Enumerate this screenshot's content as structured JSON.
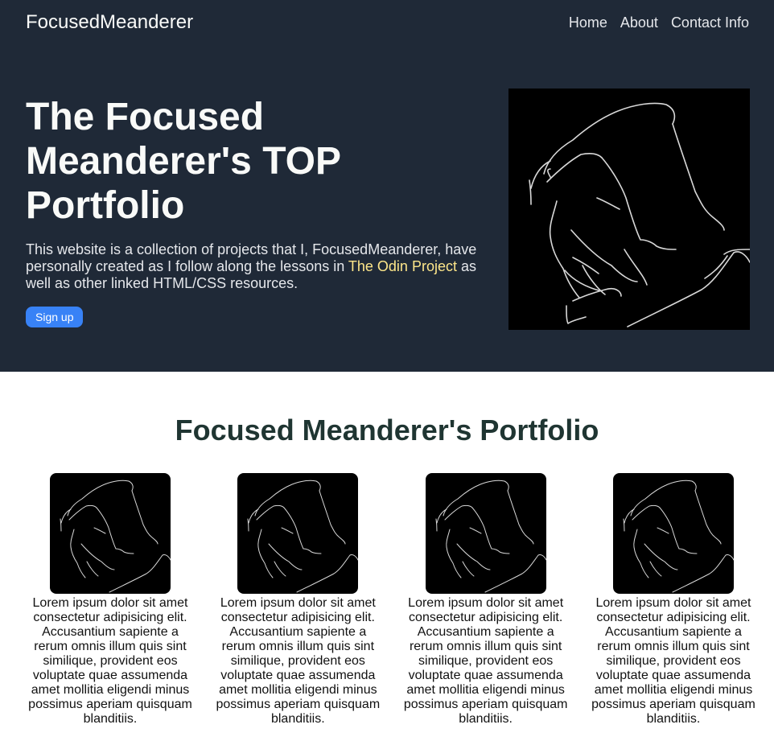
{
  "header": {
    "logo": "FocusedMeanderer",
    "nav": [
      "Home",
      "About",
      "Contact Info"
    ]
  },
  "hero": {
    "title": "The Focused Meanderer's TOP Portfolio",
    "description_before": "This website is a collection of projects that I, FocusedMeanderer, have personally created as I follow along the lessons in ",
    "link_text": "The Odin Project",
    "description_after": " as well as other linked HTML/CSS resources.",
    "signup_label": "Sign up"
  },
  "portfolio": {
    "title": "Focused Meanderer's Portfolio",
    "cards": [
      {
        "text": "Lorem ipsum dolor sit amet consectetur adipisicing elit. Accusantium sapiente a rerum omnis illum quis sint similique, provident eos voluptate quae assumenda amet mollitia eligendi minus possimus aperiam quisquam blanditiis."
      },
      {
        "text": "Lorem ipsum dolor sit amet consectetur adipisicing elit. Accusantium sapiente a rerum omnis illum quis sint similique, provident eos voluptate quae assumenda amet mollitia eligendi minus possimus aperiam quisquam blanditiis."
      },
      {
        "text": "Lorem ipsum dolor sit amet consectetur adipisicing elit. Accusantium sapiente a rerum omnis illum quis sint similique, provident eos voluptate quae assumenda amet mollitia eligendi minus possimus aperiam quisquam blanditiis."
      },
      {
        "text": "Lorem ipsum dolor sit amet consectetur adipisicing elit. Accusantium sapiente a rerum omnis illum quis sint similique, provident eos voluptate quae assumenda amet mollitia eligendi minus possimus aperiam quisquam blanditiis."
      }
    ]
  },
  "colors": {
    "hero_bg": "#1f2937",
    "accent_button": "#3882f6",
    "link": "#fde68a",
    "portfolio_title": "#1f3532"
  }
}
